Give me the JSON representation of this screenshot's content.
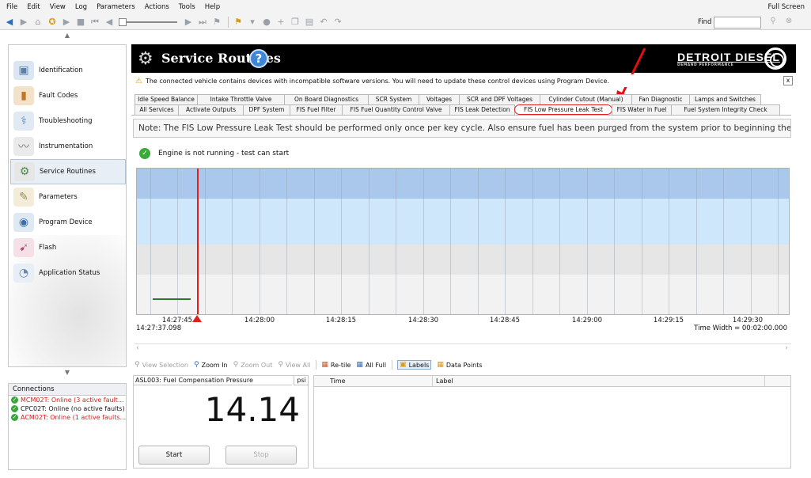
{
  "menu": {
    "items": [
      "File",
      "Edit",
      "View",
      "Log",
      "Parameters",
      "Actions",
      "Tools",
      "Help"
    ],
    "full_screen": "Full Screen"
  },
  "toolbar": {
    "find_label": "Find",
    "find_value": ""
  },
  "nav": {
    "items": [
      {
        "label": "Identification",
        "icon": "id-card-icon"
      },
      {
        "label": "Fault Codes",
        "icon": "fault-codes-icon"
      },
      {
        "label": "Troubleshooting",
        "icon": "troubleshooting-icon"
      },
      {
        "label": "Instrumentation",
        "icon": "instrumentation-icon"
      },
      {
        "label": "Service Routines",
        "icon": "service-routines-icon",
        "active": true
      },
      {
        "label": "Parameters",
        "icon": "parameters-icon"
      },
      {
        "label": "Program Device",
        "icon": "program-device-icon"
      },
      {
        "label": "Flash",
        "icon": "flash-icon"
      },
      {
        "label": "Application Status",
        "icon": "application-status-icon"
      }
    ]
  },
  "connections": {
    "title": "Connections",
    "items": [
      {
        "text": "MCM02T: Online (3 active fault...",
        "color": "#d42020"
      },
      {
        "text": "CPC02T: Online (no active faults)",
        "color": "#111111"
      },
      {
        "text": "ACM02T: Online (1 active faults...",
        "color": "#d42020"
      }
    ]
  },
  "header": {
    "title": "Service Routines",
    "help": "?",
    "brand": "DETROIT DIESEL",
    "brand_sub": "DEMAND PERFORMANCE"
  },
  "warning": {
    "text": "The connected vehicle contains devices with incompatible software versions.  You will need to update these control devices using Program Device.",
    "close": "x"
  },
  "tabs": {
    "row1": [
      "Idle Speed Balance",
      "Intake Throttle Valve",
      "On Board Diagnostics",
      "SCR System",
      "Voltages",
      "SCR and DPF Voltages",
      "Cylinder Cutout (Manual)",
      "Fan Diagnostic",
      "Lamps and Switches"
    ],
    "row2": [
      "All Services",
      "Activate Outputs",
      "DPF System",
      "FIS Fuel Filter",
      "FIS Fuel Quantity Control Valve",
      "FIS Leak Detection",
      "FIS Low Pressure Leak Test",
      "FIS Water in Fuel",
      "Fuel System Integrity Check"
    ],
    "active": "FIS Low Pressure Leak Test"
  },
  "note": "Note: The FIS Low Pressure Leak Test should be performed only once per key cycle. Also ensure fuel has been purged from the system prior to beginning the test.",
  "status": "Engine is not running - test can start",
  "chart": {
    "x_ticks": [
      "14:27:45",
      "14:28:00",
      "14:28:15",
      "14:28:30",
      "14:28:45",
      "14:29:00",
      "14:29:15",
      "14:29:30"
    ],
    "start_time": "14:27:37.098",
    "time_width": "Time Width = 00:02:00.000"
  },
  "chart_toolbar": {
    "view_selection": "View Selection",
    "zoom_in": "Zoom In",
    "zoom_out": "Zoom Out",
    "view_all": "View All",
    "retile": "Re-tile",
    "all_full": "All Full",
    "labels": "Labels",
    "data_points": "Data Points"
  },
  "gauge": {
    "name": "ASL003: Fuel Compensation Pressure",
    "unit": "psi",
    "value": "14.14",
    "start": "Start",
    "stop": "Stop"
  },
  "labels_table": {
    "columns": [
      "Time",
      "Label"
    ]
  },
  "colors": {
    "band_dark_blue": "#a9c8ec",
    "band_light_blue": "#cfe7fb",
    "band_gray": "#e6e6e6",
    "band_light": "#f2f2f2",
    "accent_red": "#e02020",
    "ok_green": "#3aa53a"
  }
}
